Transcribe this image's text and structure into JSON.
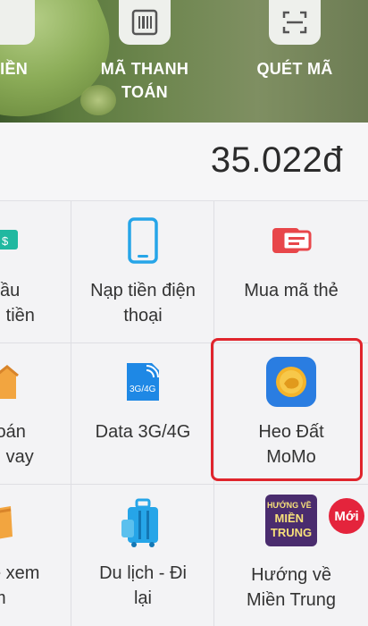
{
  "header": {
    "btn1_label": "TIỀN",
    "btn2_label": "MÃ THANH\nTOÁN",
    "btn3_label": "QUÉT MÃ"
  },
  "balance": {
    "amount": "35.022đ"
  },
  "services": [
    {
      "label": "cầu\nn tiền",
      "icon": "money-transfer-icon"
    },
    {
      "label": "Nạp tiền điện\nthoại",
      "icon": "phone-icon"
    },
    {
      "label": "Mua mã thẻ",
      "icon": "card-code-icon"
    },
    {
      "label": "toán\nn vay",
      "icon": "house-icon"
    },
    {
      "label": "Data 3G/4G",
      "icon": "sim-3g4g-icon",
      "icon_text": "3G/4G"
    },
    {
      "label": "Heo Đất\nMoMo",
      "icon": "piggy-coin-icon"
    },
    {
      "label": "é xem\nm",
      "icon": "ticket-icon"
    },
    {
      "label": "Du lịch -  Đi\nlại",
      "icon": "luggage-icon"
    },
    {
      "label": "Hướng về\nMiền Trung",
      "icon": "campaign-icon",
      "icon_text": "HƯỚNG VỀ\nMIỀN\nTRUNG",
      "badge": "Mới"
    }
  ],
  "colors": {
    "highlight": "#e0242c",
    "accent_blue": "#1e88e5",
    "accent_red": "#e4243c"
  }
}
